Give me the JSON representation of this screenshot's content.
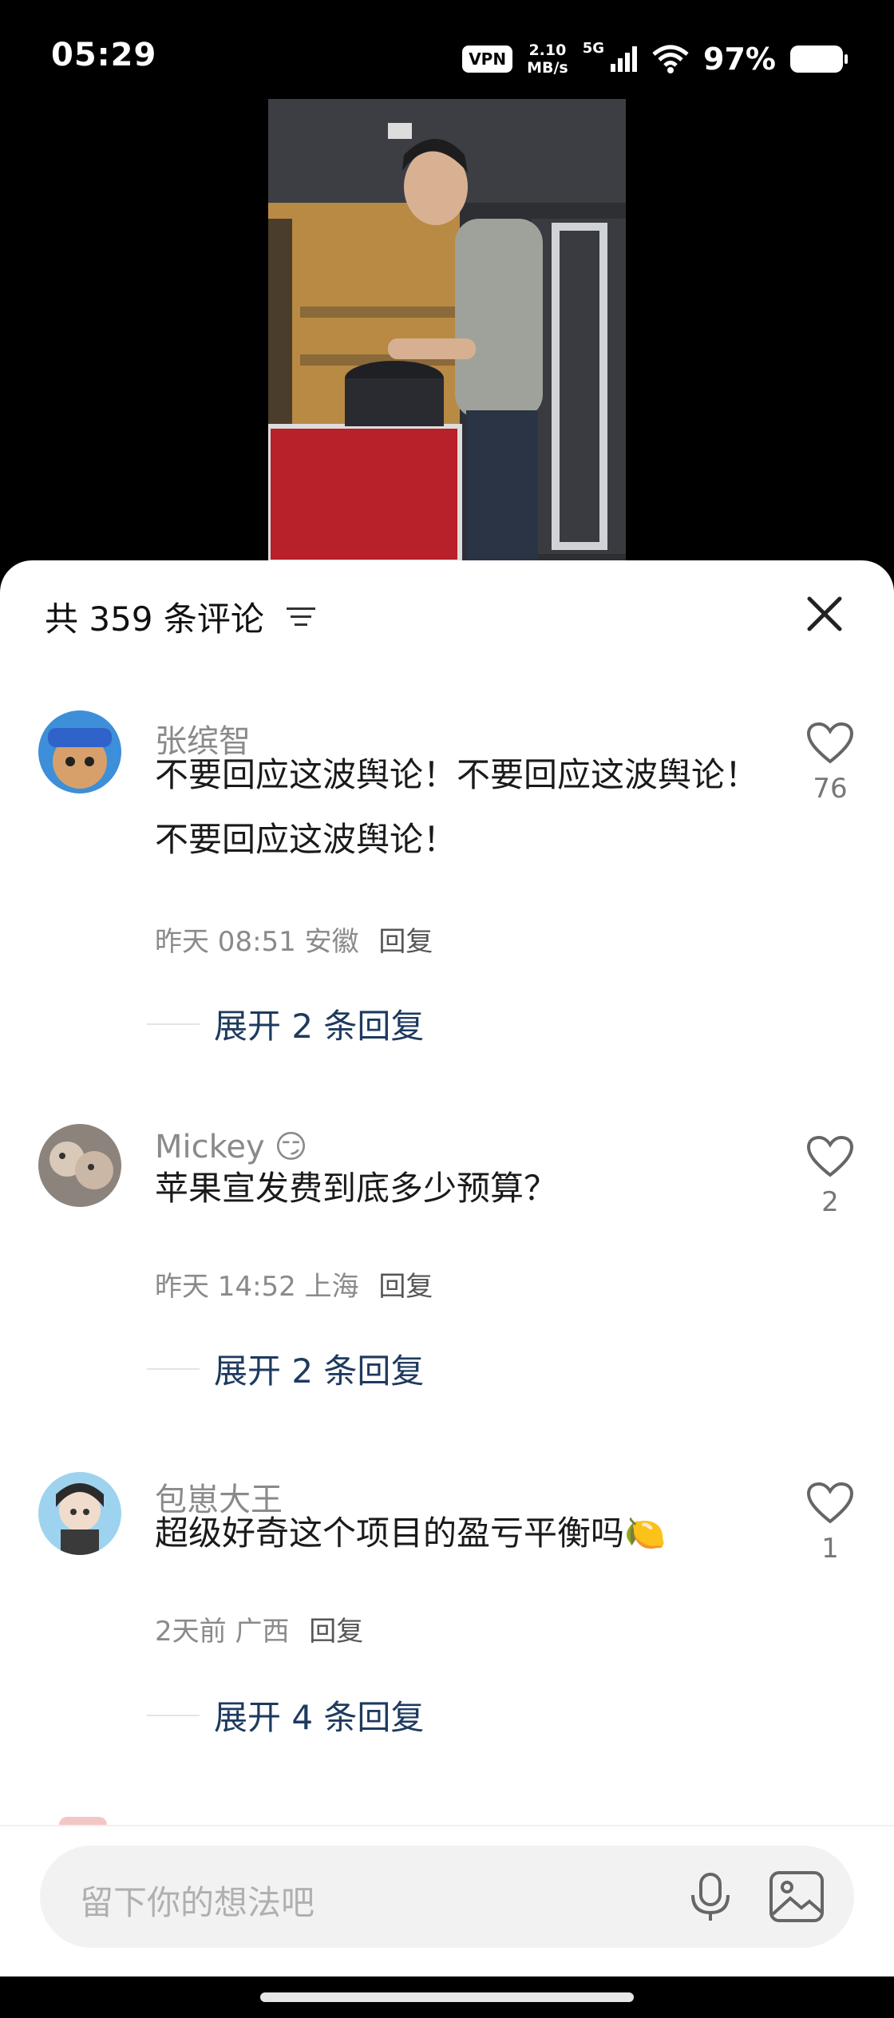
{
  "status_bar": {
    "time": "05:29",
    "vpn": "VPN",
    "speed_value": "2.10",
    "speed_unit": "MB/s",
    "network": "5G",
    "battery": "97%"
  },
  "sheet": {
    "title": "共 359 条评论",
    "filter_icon": "filter-icon",
    "close_icon": "close-icon"
  },
  "comments": [
    {
      "user": "张缤智",
      "text": "不要回应这波舆论！不要回应这波舆论！不要回应这波舆论！",
      "time": "昨天 08:51",
      "location": "安徽",
      "reply_label": "回复",
      "likes": "76",
      "expand": "展开 2 条回复"
    },
    {
      "user": "Mickey",
      "user_emoji": "😏",
      "text": "苹果宣发费到底多少预算？",
      "time": "昨天 14:52",
      "location": "上海",
      "reply_label": "回复",
      "likes": "2",
      "expand": "展开 2 条回复"
    },
    {
      "user": "包崽大王",
      "text": "超级好奇这个项目的盈亏平衡吗",
      "text_emoji": "🍋",
      "time": "2天前",
      "location": "广西",
      "reply_label": "回复",
      "likes": "1",
      "expand": "展开 4 条回复"
    }
  ],
  "input": {
    "placeholder": "留下你的想法吧",
    "mic_icon": "microphone-icon",
    "image_icon": "image-icon"
  },
  "colors": {
    "link": "#1e3a5f",
    "meta": "#8a8a8a",
    "sheet_bg": "#ffffff"
  }
}
